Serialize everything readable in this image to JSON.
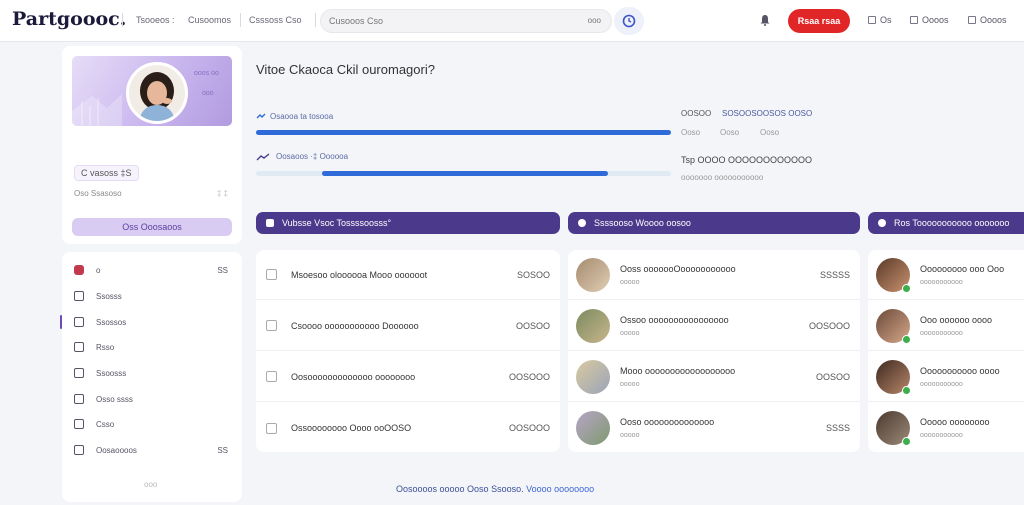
{
  "app": {
    "logo": "Partgoooc."
  },
  "nav": {
    "links": [
      "Tsooeos :",
      "Cusoomos",
      "Csssoss Cso",
      "Cusooos Cso"
    ],
    "search_placeholder": "Cusooos Cso",
    "search_kbd": "ooo",
    "cta_label": "Rsaa rsaa",
    "utils": [
      "Os",
      "Oooos",
      "Oooos"
    ]
  },
  "profile": {
    "banner_tag_top": "ooos oo",
    "banner_tag_mid": "ooo",
    "name": "C vasoss  ‡S",
    "subtitle": "Oso Ssasoso",
    "subtitle_right": "‡ ‡",
    "button": "Oss Ooosaoos"
  },
  "menu": {
    "items": [
      {
        "label": "o",
        "count": "SS"
      },
      {
        "label": "Ssosss",
        "count": ""
      },
      {
        "label": "Ssossos",
        "count": ""
      },
      {
        "label": "Rsso",
        "count": ""
      },
      {
        "label": "Ssoosss",
        "count": ""
      },
      {
        "label": "Osso ssss",
        "count": ""
      },
      {
        "label": "Csso",
        "count": ""
      },
      {
        "label": "Oosaoooos",
        "count": "SS"
      }
    ],
    "footer": "ooo"
  },
  "main": {
    "title": "Vitoe Ckaoca Ckil ouromagori?",
    "progress": [
      {
        "label": "Osaooa ta tosooa",
        "value": 1.0
      },
      {
        "label": "Oosaoos  ·‡ Oooooa",
        "value": 0.82
      }
    ],
    "stats": {
      "line1_a": "OOSOO",
      "line1_b": "SOSOOSOOSOS OOSO",
      "line2": [
        "Ooso",
        "Ooso",
        "Ooso"
      ],
      "line3": "Tsp OOOO OOOOOOOOOOOO",
      "line4": "ooooooo ooooooooooo"
    }
  },
  "columns": [
    {
      "title": "Vubsse Vsoc Tossssoosss°",
      "rows": [
        {
          "text": "Msoesoo oloooooa Mooo oooooot",
          "value": "SOSOO"
        },
        {
          "text": "Csoooo ooooooooooo Doooooo",
          "value": "OOSOO"
        },
        {
          "text": "Oosooooooooooooo oooooooo",
          "value": "OOSOOO"
        },
        {
          "text": "Ossoooooooo Oooo ooOOSO",
          "value": "OOSOOO"
        }
      ]
    },
    {
      "title": "Ssssooso Woooo oosoo",
      "rows": [
        {
          "text": "Ooss ooooooOooooooooooo",
          "sub": "ooooo",
          "value": "SSSSS"
        },
        {
          "text": "Ossoo oooooooooooooooo",
          "sub": "ooooo",
          "value": "OOSOOO"
        },
        {
          "text": "Mooo oooooooooooooooooo",
          "sub": "ooooo",
          "value": "OOSOO"
        },
        {
          "text": "Ooso oooooooooooooo",
          "sub": "ooooo",
          "value": "SSSS"
        }
      ]
    },
    {
      "title": "Ros Tooooooooooo ooooooo",
      "rows": [
        {
          "text": "Ooooooooo ooo Ooo",
          "sub": "ooooooooooo"
        },
        {
          "text": "Ooo oooooo oooo",
          "sub": "ooooooooooo"
        },
        {
          "text": "Ooooooooooo oooo",
          "sub": "ooooooooooo"
        },
        {
          "text": "Ooooo oooooooo",
          "sub": "ooooooooooo"
        }
      ]
    }
  ],
  "footer": {
    "text": "Oosoooos ooooo Ooso Ssooso.",
    "link": "Voooo oooooooo"
  },
  "colors": {
    "accent": "#4b3a8c",
    "cta": "#e02626",
    "progress": "#2f6bd8",
    "online": "#3cae4a"
  }
}
